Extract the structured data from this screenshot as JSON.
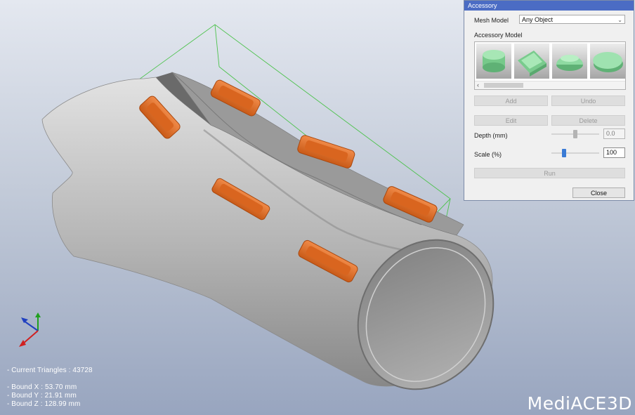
{
  "viewport": {
    "stats": {
      "triangles": "- Current Triangles : 43728",
      "bound_x": "- Bound X : 53.70 mm",
      "bound_y": "- Bound Y : 21.91 mm",
      "bound_z": "- Bound Z : 128.99 mm"
    },
    "logo": "MediACE3D",
    "colors": {
      "mesh": "#a9a9a9",
      "accessory": "#e8702a",
      "bounding_box": "#4cc24c",
      "axis_x": "#d02020",
      "axis_y": "#20a020",
      "axis_z": "#2040c0"
    }
  },
  "panel": {
    "title": "Accessory",
    "mesh_model_label": "Mesh Model",
    "mesh_model_value": "Any Object",
    "accessory_model_label": "Accessory Model",
    "thumbnails": [
      "cylinder-cap",
      "rounded-bar",
      "dome-cap",
      "oval-cap"
    ],
    "buttons": {
      "add": "Add",
      "undo": "Undo",
      "edit": "Edit",
      "delete": "Delete",
      "run": "Run",
      "close": "Close"
    },
    "depth_label": "Depth (mm)",
    "depth_value": "0.0",
    "scale_label": "Scale (%)",
    "scale_value": "100",
    "accent": "#3a7bd5"
  }
}
